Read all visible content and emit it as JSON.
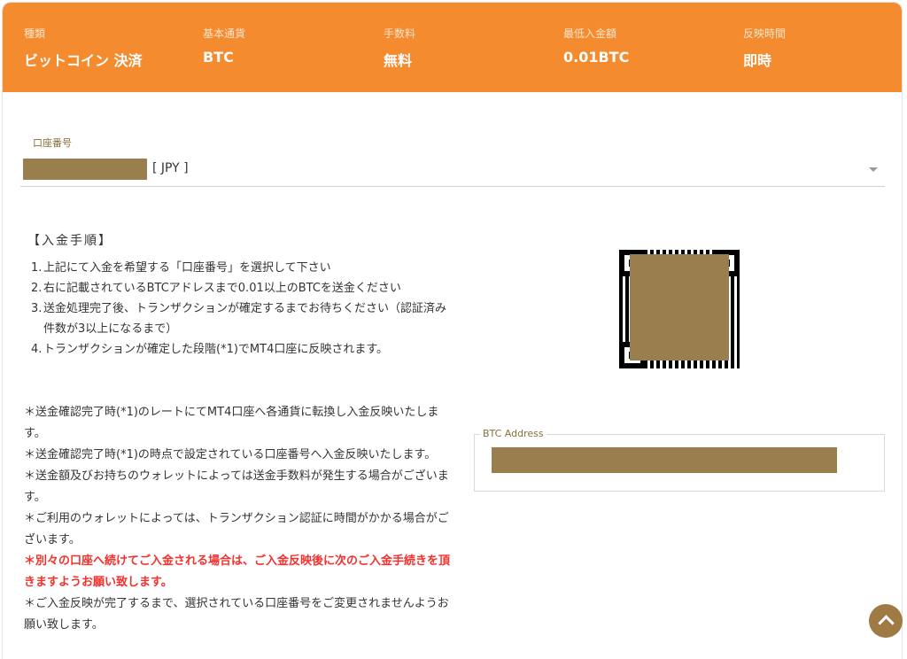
{
  "header": {
    "columns": [
      {
        "label": "種類",
        "value": "ビットコイン 決済"
      },
      {
        "label": "基本通貨",
        "value": "BTC"
      },
      {
        "label": "手数料",
        "value": "無料"
      },
      {
        "label": "最低入金額",
        "value": "0.01BTC"
      },
      {
        "label": "反映時間",
        "value": "即時"
      }
    ]
  },
  "account": {
    "label": "口座番号",
    "currency": "[ JPY ]"
  },
  "procedure": {
    "title": "【入金手順】",
    "steps": [
      {
        "num": "1.",
        "text": "上記にて入金を希望する「口座番号」を選択して下さい"
      },
      {
        "num": "2.",
        "text": "右に記載されているBTCアドレスまで0.01以上のBTCを送金ください"
      },
      {
        "num": "3.",
        "text": "送金処理完了後、トランザクションが確定するまでお待ちください（認証済み件数が3以上になるまで）"
      },
      {
        "num": "4.",
        "text": "トランザクションが確定した段階(*1)でMT4口座に反映されます。"
      }
    ]
  },
  "notes": [
    "＊送金確認完了時(*1)のレートにてMT4口座へ各通貨に転換し入金反映いたします。",
    "＊送金確認完了時(*1)の時点で設定されている口座番号へ入金反映いたします。",
    "＊送金額及びお持ちのウォレットによっては送金手数料が発生する場合がございます。",
    "＊ご利用のウォレットによっては、トランザクション認証に時間がかかる場合がございます。",
    "＊別々の口座へ続けてご入金される場合は、ご入金反映後に次のご入金手続きを頂きますようお願い致します。",
    "＊ご入金反映が完了するまで、選択されている口座番号をご変更されませんようお願い致します。"
  ],
  "btc": {
    "legend": "BTC Address"
  },
  "colors": {
    "header_bg": "#f58b2f",
    "mask": "#9a7f4e",
    "warning_text": "#f2312d",
    "scroll_button": "#a07a45"
  },
  "icons": {
    "select_caret": "chevron-down-icon",
    "scroll_top": "chevron-up-icon"
  }
}
